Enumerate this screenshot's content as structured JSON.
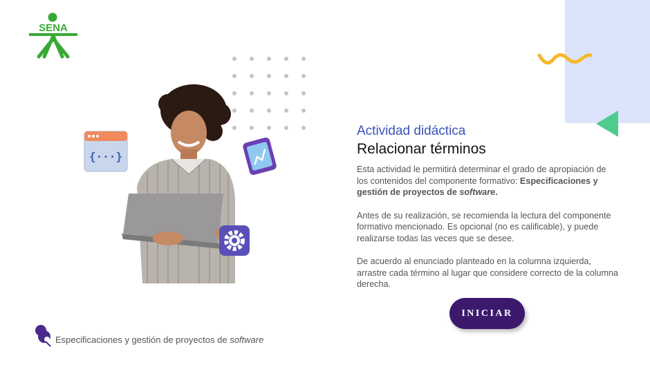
{
  "brand": {
    "logo_text": "SENA",
    "logo_color": "#39a935"
  },
  "colors": {
    "accent_blue": "#3a52b8",
    "button_bg": "#3b1a6e",
    "panel_bg": "#dbe4fb",
    "wave": "#f5b82e",
    "triangle": "#4ecb8f"
  },
  "header": {
    "kicker": "Actividad didáctica",
    "title": "Relacionar términos"
  },
  "description": {
    "p1_prefix": "Esta actividad le permitirá determinar el grado de apropiación de los contenidos del componente formativo: ",
    "p1_bold": "Especificaciones y gestión de proyectos de ",
    "p1_bold_italic": "software",
    "p1_suffix": ".",
    "p2": "Antes de su realización, se recomienda la lectura del componente formativo mencionado.  Es opcional (no es calificable), y puede realizarse todas las veces que se desee.",
    "p3": "De acuerdo al enunciado planteado en la columna izquierda, arrastre cada término al lugar que considere correcto de la columna derecha."
  },
  "actions": {
    "start_label": "INICIAR"
  },
  "footer": {
    "text": "Especificaciones y gestión de proyectos de ",
    "text_italic": "software"
  },
  "hero": {
    "icons": [
      "code-window-icon",
      "clipboard-chart-icon",
      "settings-gear-icon"
    ]
  }
}
